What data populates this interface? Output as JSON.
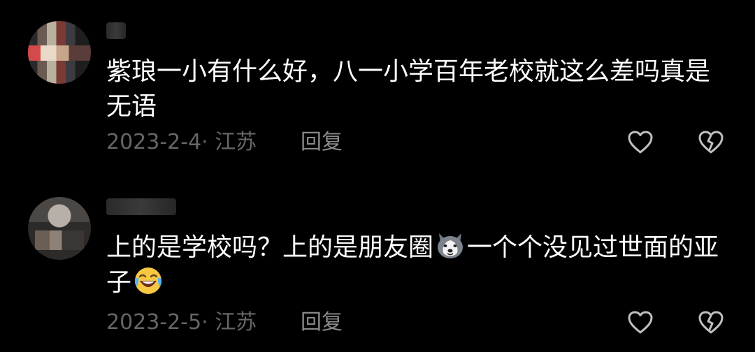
{
  "comments": [
    {
      "text": "紫琅一小有什么好，八一小学百年老校就这么差吗真是无语",
      "date": "2023-2-4",
      "location": "江苏",
      "reply_label": "回复",
      "like_icon": "heart-outline-icon",
      "dislike_icon": "broken-heart-icon"
    },
    {
      "text_part1": "上的是学校吗？上的是朋友圈",
      "emoji1": "husky-dog-emoji",
      "text_part2": "一个个没见过世面的亚子",
      "emoji2": "laughing-tears-emoji",
      "date": "2023-2-5",
      "location": "江苏",
      "reply_label": "回复",
      "like_icon": "heart-outline-icon",
      "dislike_icon": "broken-heart-icon"
    }
  ],
  "colors": {
    "background": "#000000",
    "text": "#ffffff",
    "meta": "#666666",
    "reply": "#8a8a8a",
    "icon": "#bfbfbf"
  },
  "meta_separator": "· "
}
